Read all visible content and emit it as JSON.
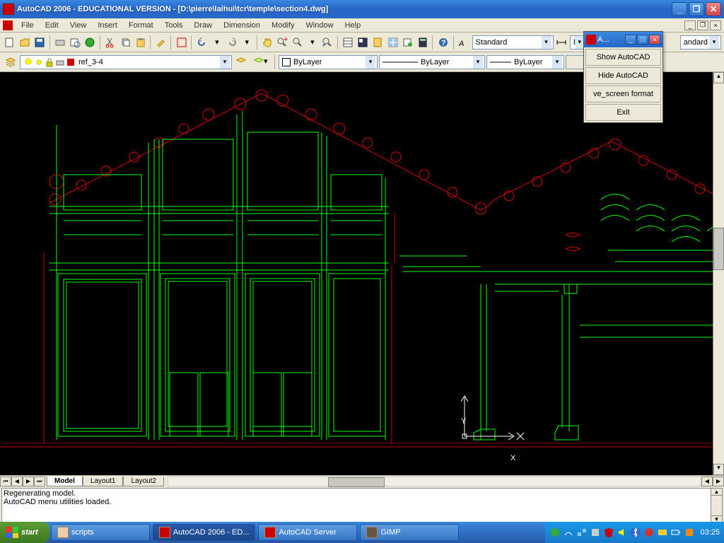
{
  "titlebar": {
    "title": "AutoCAD 2006 - EDUCATIONAL VERSION - [D:\\pierre\\laihui\\tcr\\temple\\section4.dwg]"
  },
  "menubar": {
    "items": [
      "File",
      "Edit",
      "View",
      "Insert",
      "Format",
      "Tools",
      "Draw",
      "Dimension",
      "Modify",
      "Window",
      "Help"
    ]
  },
  "toolbar_combos": {
    "text_style": "Standard",
    "dim_style": "ISO",
    "right_style": "andard"
  },
  "layer_bar": {
    "current_layer": "ref_3-4",
    "color_value": "ByLayer",
    "linetype_value": "ByLayer",
    "lineweight_value": "ByLayer"
  },
  "tabs": {
    "model": "Model",
    "layout1": "Layout1",
    "layout2": "Layout2"
  },
  "cmdline": {
    "line1": "Regenerating model.",
    "line2": "AutoCAD menu utilities loaded."
  },
  "ucs": {
    "x_label": "X",
    "y_label": "Y"
  },
  "popup": {
    "title": "A...",
    "items": [
      "Show AutoCAD",
      "Hide AutoCAD",
      "ve_screen format",
      "Exit"
    ]
  },
  "taskbar": {
    "start": "start",
    "tasks": [
      "scripts",
      "AutoCAD 2006 - ED...",
      "AutoCAD Server",
      "GIMP"
    ],
    "clock": "03:25"
  }
}
